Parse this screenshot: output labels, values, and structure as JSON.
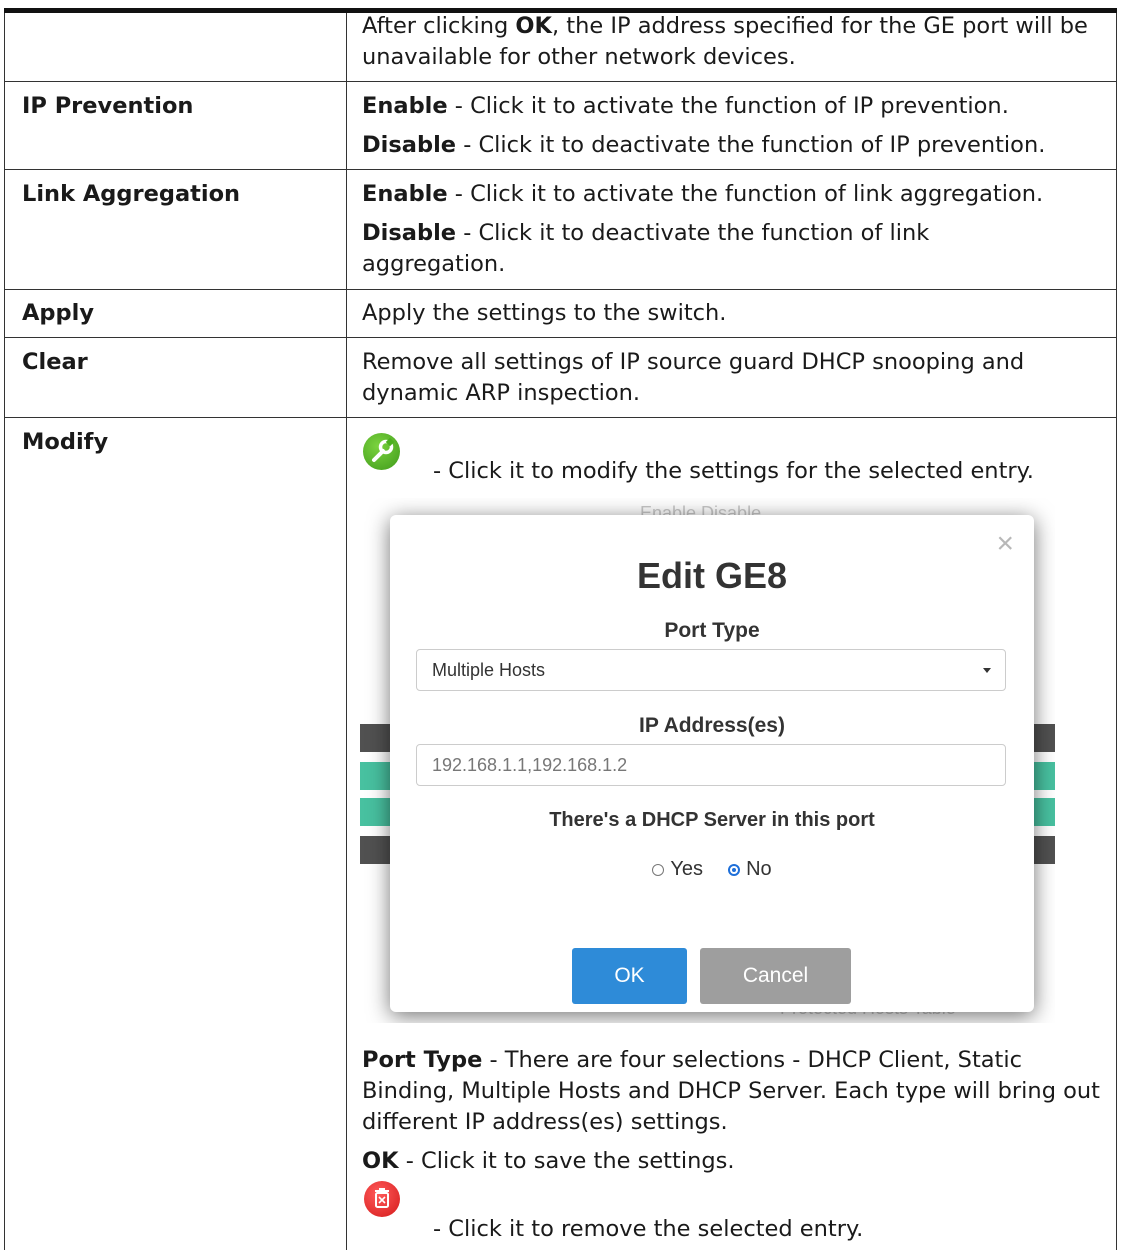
{
  "rows": [
    {
      "label": "",
      "paragraphs": [
        {
          "bold_pre": "",
          "pre": "After clicking ",
          "bold": "OK",
          "post": ", the IP address specified for the GE port will be unavailable for other network devices."
        }
      ]
    },
    {
      "label": "IP Prevention",
      "paragraphs": [
        {
          "bold": "Enable",
          "post": " - Click it to activate the function of IP prevention."
        },
        {
          "bold": "Disable",
          "post": " - Click it to deactivate the function of IP prevention."
        }
      ]
    },
    {
      "label": "Link Aggregation",
      "paragraphs": [
        {
          "bold": "Enable",
          "post": " - Click it to activate the function of link aggregation."
        },
        {
          "bold": "Disable",
          "post": " - Click it to deactivate the function of link aggregation."
        }
      ]
    },
    {
      "label": "Apply",
      "text": "Apply the settings to the switch."
    },
    {
      "label": "Clear",
      "text": "Remove all settings of IP source guard DHCP snooping and dynamic ARP inspection."
    },
    {
      "label": "Modify"
    }
  ],
  "modify": {
    "wrench_text": "- Click it to modify the settings for the selected entry.",
    "port_type_bold": "Port Type",
    "port_type_text": " - There are four selections - DHCP Client, Static Binding, Multiple Hosts and DHCP Server. Each type will bring out different IP address(es) settings.",
    "ok_bold": "OK",
    "ok_text": " - Click it to save the settings.",
    "trash_text": "- Click it to remove the selected entry."
  },
  "dialog": {
    "bg_text": "Enable   Disable",
    "bg_footer": "Protected Hosts Table",
    "title": "Edit GE8",
    "port_type_label": "Port Type",
    "port_type_value": "Multiple Hosts",
    "ip_label": "IP Address(es)",
    "ip_value": "192.168.1.1,192.168.1.2",
    "dhcp_label": "There's a DHCP Server in this port",
    "yes": "Yes",
    "no": "No",
    "selected": "No",
    "ok": "OK",
    "cancel": "Cancel",
    "close": "×"
  },
  "colors": {
    "wrench": "#4caf20",
    "trash": "#e02020",
    "ok_button": "#2e8bd8",
    "cancel_button": "#9e9e9e"
  }
}
